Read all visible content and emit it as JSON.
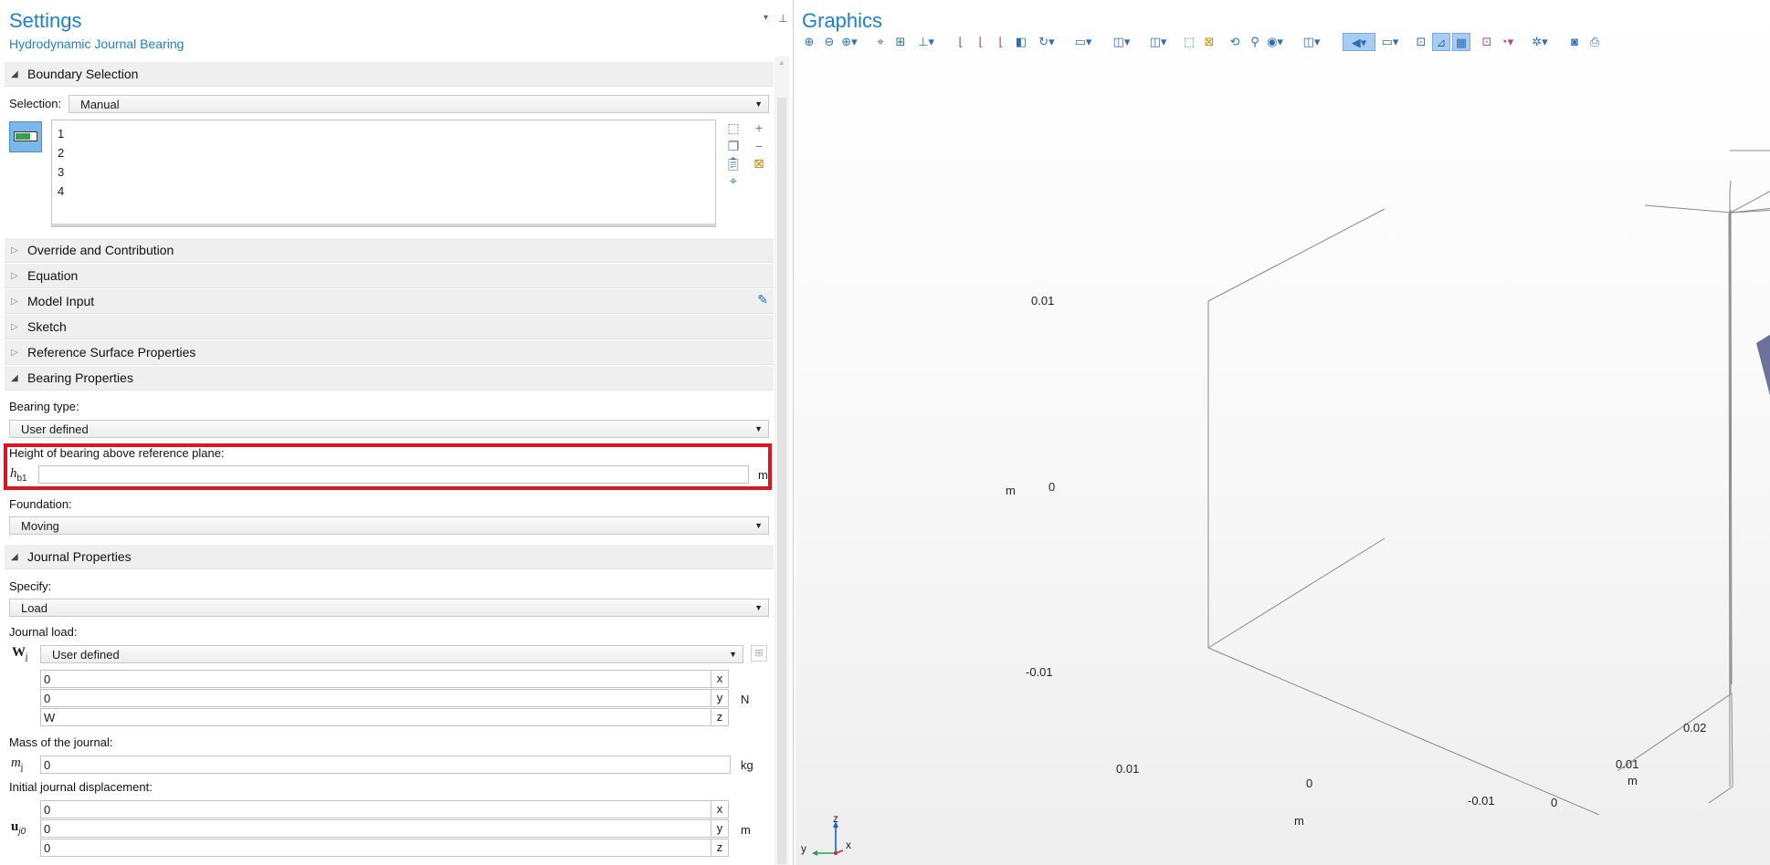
{
  "settings": {
    "title": "Settings",
    "subtitle": "Hydrodynamic Journal Bearing",
    "boundary_selection": {
      "header": "Boundary Selection",
      "selection_label": "Selection:",
      "selection_value": "Manual",
      "items": [
        "1",
        "2",
        "3",
        "4"
      ]
    },
    "sections": {
      "override": "Override and Contribution",
      "equation": "Equation",
      "model_input": "Model Input",
      "sketch": "Sketch",
      "reference_surface": "Reference Surface Properties"
    },
    "bearing_properties": {
      "header": "Bearing Properties",
      "type_label": "Bearing type:",
      "type_value": "User defined",
      "height_label": "Height of bearing above reference plane:",
      "height_symbol": "h",
      "height_sub": "b1",
      "height_value": "",
      "height_unit": "m",
      "foundation_label": "Foundation:",
      "foundation_value": "Moving"
    },
    "journal_properties": {
      "header": "Journal Properties",
      "specify_label": "Specify:",
      "specify_value": "Load",
      "load_label": "Journal load:",
      "load_symbol": "W",
      "load_sub": "j",
      "load_mode": "User defined",
      "load_components": [
        {
          "value": "0",
          "axis": "x"
        },
        {
          "value": "0",
          "axis": "y"
        },
        {
          "value": "W",
          "axis": "z"
        }
      ],
      "load_unit": "N",
      "mass_label": "Mass of the journal:",
      "mass_symbol": "m",
      "mass_sub": "j",
      "mass_value": "0",
      "mass_unit": "kg",
      "disp_label": "Initial journal displacement:",
      "disp_symbol": "u",
      "disp_sub": "j0",
      "disp_components": [
        {
          "value": "0",
          "axis": "x"
        },
        {
          "value": "0",
          "axis": "y"
        },
        {
          "value": "0",
          "axis": "z"
        }
      ],
      "disp_unit": "m"
    }
  },
  "graphics": {
    "title": "Graphics",
    "axis_ticks": {
      "vertical": [
        "0.01",
        "0",
        "-0.01"
      ],
      "vertical_unit": "m",
      "left_horizontal": [
        "0.01",
        "0",
        "-0.01"
      ],
      "left_unit": "m",
      "right_horizontal": [
        "0.02",
        "0.01",
        "0"
      ],
      "right_unit": "m"
    },
    "triad": {
      "z": "z",
      "y": "y",
      "x": "x"
    },
    "colors": {
      "surface": "#8f93cc",
      "edges": "#1a1adc",
      "highlight_box": "#e0141e"
    }
  }
}
